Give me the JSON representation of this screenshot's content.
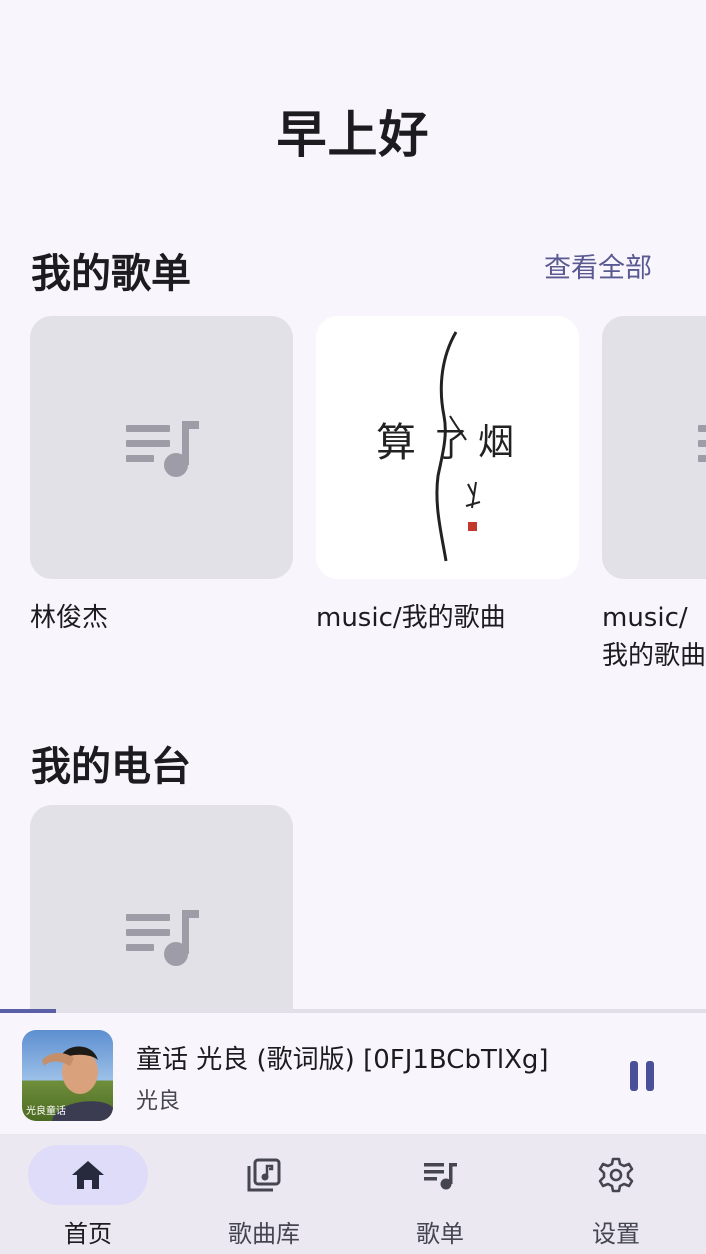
{
  "greeting": "早上好",
  "playlists_section": {
    "title": "我的歌单",
    "view_all": "查看全部",
    "items": [
      {
        "label": "林俊杰",
        "cover": "placeholder"
      },
      {
        "label": "music/我的歌曲",
        "cover": "calligraphy-art",
        "cover_text": [
          "算",
          "了",
          "烟"
        ]
      },
      {
        "label": "music/我的歌曲",
        "cover": "placeholder"
      }
    ]
  },
  "radio_section": {
    "title": "我的电台",
    "items": [
      {
        "label": "",
        "cover": "placeholder"
      }
    ]
  },
  "player": {
    "title": "童话 光良 (歌词版) [0FJ1BCbTlXg]",
    "artist": "光良",
    "progress": 0.08,
    "album_art_text": "光良童话",
    "state_icon": "pause-icon"
  },
  "nav": {
    "items": [
      {
        "label": "首页",
        "icon": "home-icon",
        "active": true
      },
      {
        "label": "歌曲库",
        "icon": "library-icon",
        "active": false
      },
      {
        "label": "歌单",
        "icon": "playlist-icon",
        "active": false
      },
      {
        "label": "设置",
        "icon": "settings-icon",
        "active": false
      }
    ]
  },
  "colors": {
    "accent": "#5a5fa6",
    "background": "#f8f5fc",
    "placeholder": "#e2e1e8",
    "nav_active_pill": "#dedcf8",
    "nav_background": "#ebe8f1"
  }
}
